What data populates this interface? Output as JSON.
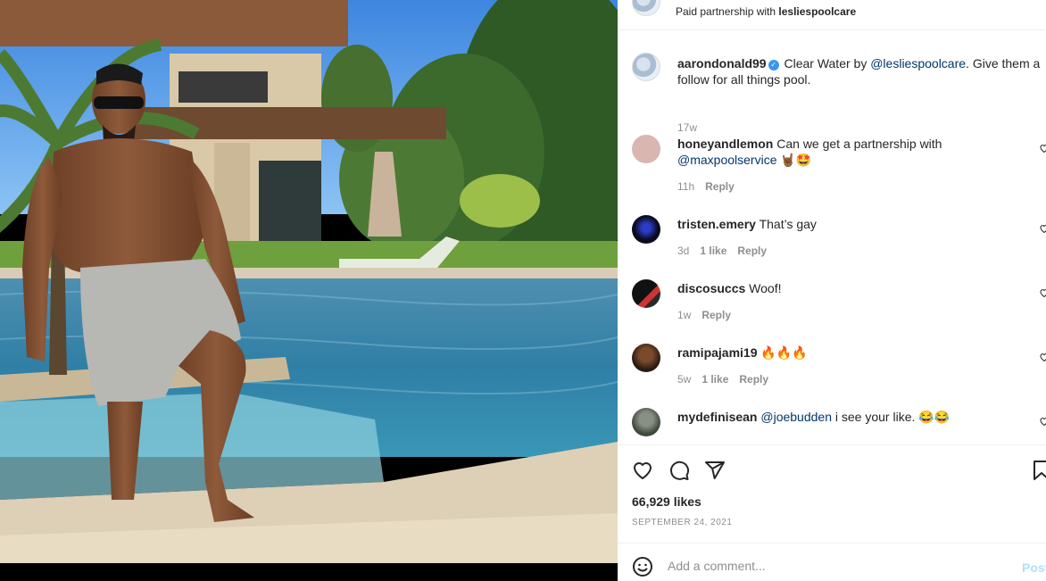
{
  "header": {
    "partner_prefix": "Paid partnership with ",
    "partner_name": "lesliespoolcare"
  },
  "caption": {
    "username": "aarondonald99",
    "text_before": " Clear Water by ",
    "mention": "@lesliespoolcare",
    "text_after": ". Give them a",
    "line2": "follow for all things pool.",
    "time": "17w"
  },
  "comments": [
    {
      "username": "honeyandlemon",
      "text": " Can we get a partnership with",
      "mention": "@maxpoolservice",
      "emoji": "🤘🏾🤩",
      "time": "11h",
      "likes": "",
      "reply": "Reply"
    },
    {
      "username": "tristen.emery",
      "text": " That’s gay",
      "time": "3d",
      "likes": "1 like",
      "reply": "Reply"
    },
    {
      "username": "discosuccs",
      "text": " Woof!",
      "time": "1w",
      "likes": "",
      "reply": "Reply"
    },
    {
      "username": "ramipajami19",
      "text": " 🔥🔥🔥",
      "time": "5w",
      "likes": "1 like",
      "reply": "Reply"
    },
    {
      "username": "mydefinisean",
      "text": " i see your like. 😂😂",
      "mention": "@joebudden",
      "time": "",
      "likes": "",
      "reply": ""
    }
  ],
  "stats": {
    "likes": "66,929 likes",
    "date": "SEPTEMBER 24, 2021"
  },
  "add_comment": {
    "placeholder": "Add a comment...",
    "post_label": "Post"
  },
  "colors": {
    "link": "#00376b",
    "secondary_text": "#8e8e8e",
    "post_button_disabled": "#b2dffc",
    "verified": "#3897f0"
  },
  "icons": [
    "heart-icon",
    "comment-icon",
    "share-icon",
    "bookmark-icon",
    "emoji-icon",
    "verified-badge-icon"
  ]
}
